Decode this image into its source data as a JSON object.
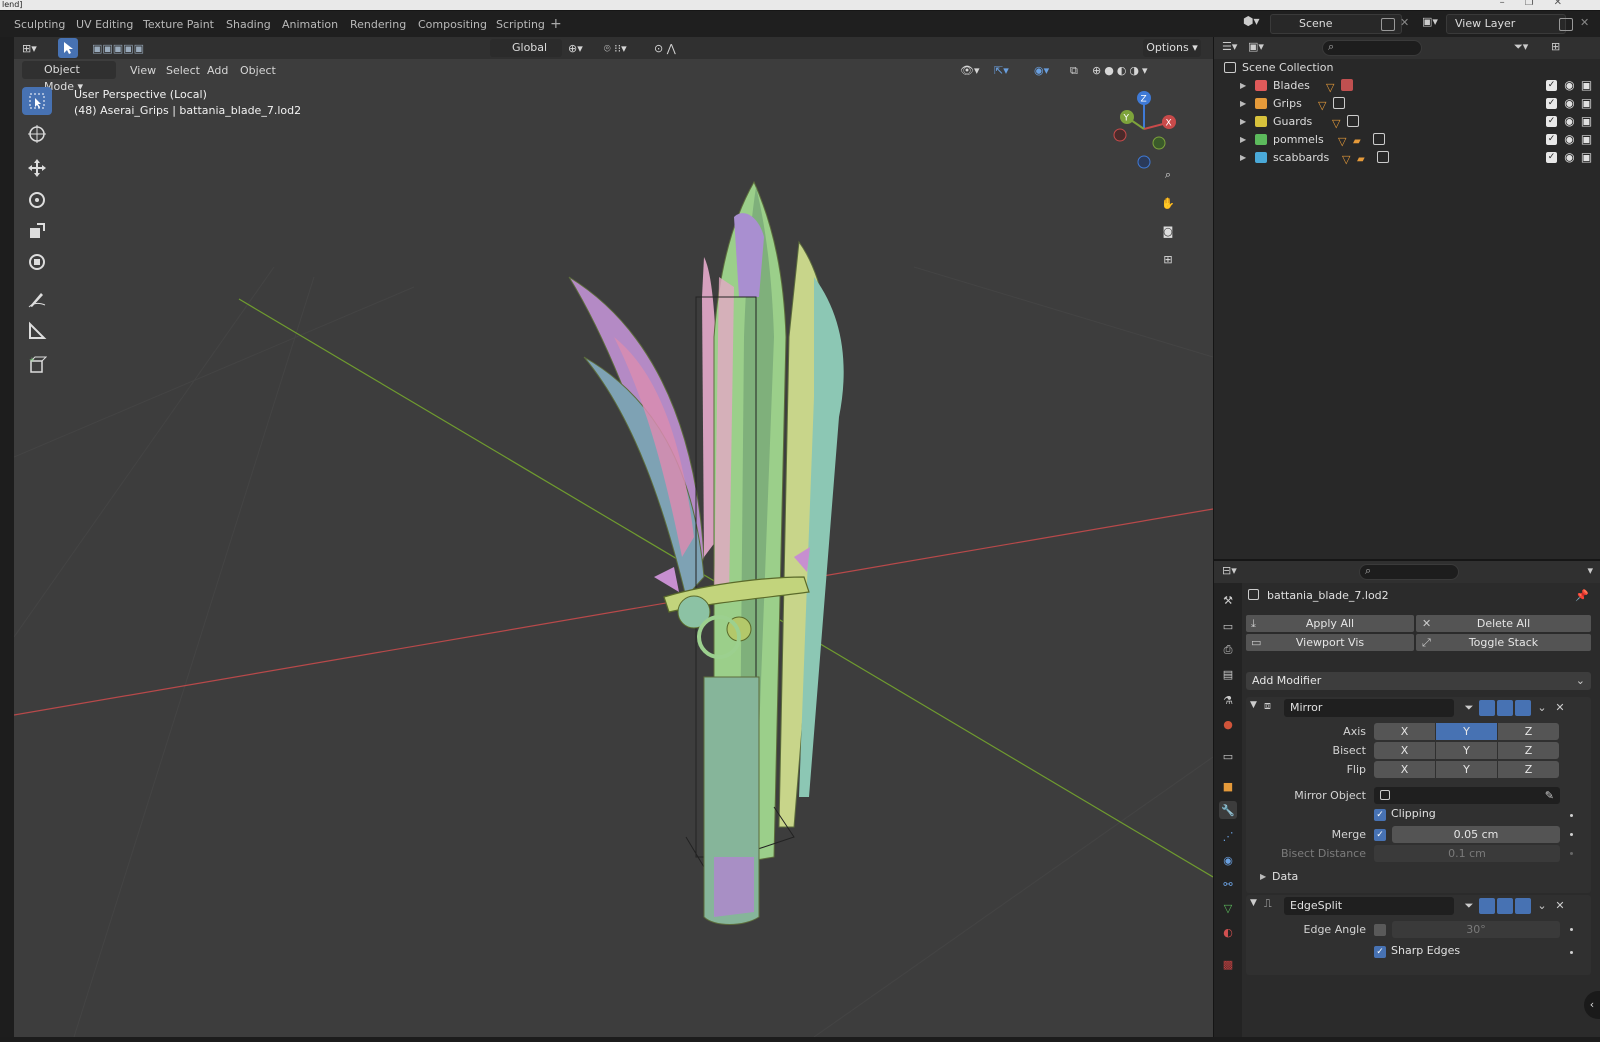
{
  "window": {
    "title": "lend]"
  },
  "workspace_tabs": [
    "Sculpting",
    "UV Editing",
    "Texture Paint",
    "Shading",
    "Animation",
    "Rendering",
    "Compositing",
    "Scripting"
  ],
  "scene": {
    "label": "Scene"
  },
  "view_layer": {
    "label": "View Layer"
  },
  "viewport": {
    "transform_orientation": "Global",
    "options_label": "Options",
    "mode": "Object Mode",
    "menus": [
      "View",
      "Select",
      "Add",
      "Object"
    ],
    "perspective_text": "User Perspective (Local)",
    "object_info_text": "(48) Aserai_Grips | battania_blade_7.lod2",
    "tools": [
      "select-box-icon",
      "cursor-icon",
      "move-icon",
      "rotate-icon",
      "scale-icon",
      "transform-icon",
      "annotate-icon",
      "measure-icon",
      "add-cube-icon"
    ],
    "gizmo_axes": {
      "x": "X",
      "y": "Y",
      "z": "Z"
    }
  },
  "outliner": {
    "root": "Scene Collection",
    "collections": [
      {
        "name": "Blades",
        "color": "#e05a5a"
      },
      {
        "name": "Grips",
        "color": "#e59a3a"
      },
      {
        "name": "Guards",
        "color": "#d8c23c"
      },
      {
        "name": "pommels",
        "color": "#5cba5c"
      },
      {
        "name": "scabbards",
        "color": "#4aa9d8"
      }
    ]
  },
  "properties": {
    "object_name": "battania_blade_7.lod2",
    "apply_all": "Apply All",
    "delete_all": "Delete All",
    "viewport_vis": "Viewport Vis",
    "toggle_stack": "Toggle Stack",
    "add_modifier": "Add Modifier",
    "mirror": {
      "name": "Mirror",
      "axis_label": "Axis",
      "bisect_label": "Bisect",
      "flip_label": "Flip",
      "x": "X",
      "y": "Y",
      "z": "Z",
      "mirror_object_label": "Mirror Object",
      "clipping_label": "Clipping",
      "merge_label": "Merge",
      "merge_value": "0.05 cm",
      "bisect_distance_label": "Bisect Distance",
      "bisect_distance_value": "0.1 cm",
      "data_label": "Data"
    },
    "edgesplit": {
      "name": "EdgeSplit",
      "edge_angle_label": "Edge Angle",
      "edge_angle_value": "30°",
      "sharp_edges_label": "Sharp Edges"
    }
  },
  "colors": {
    "accent": "#4772b3",
    "x_axis": "#c84a4a",
    "y_axis": "#7da33b",
    "z_axis": "#3f7ad6"
  }
}
